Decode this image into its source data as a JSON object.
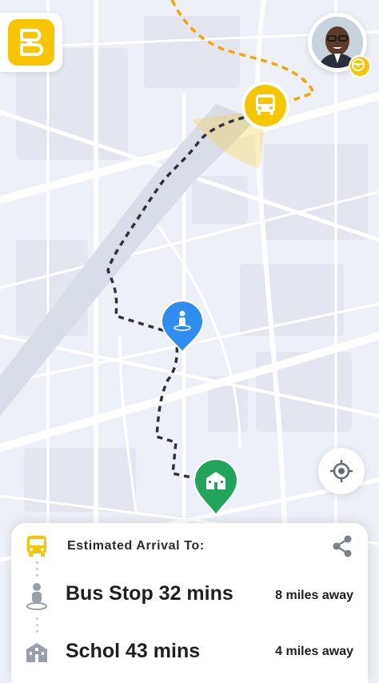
{
  "colors": {
    "accent": "#f7c600",
    "route_to_stop": "#333333",
    "route_bus": "#f0a800",
    "stop_pin": "#2f8df0",
    "school_pin": "#22a45a",
    "map_bg": "#eef0f7"
  },
  "icons": {
    "app_logo": "app-logo-icon",
    "bus_marker": "bus-icon",
    "stop_marker": "person-pin-icon",
    "school_marker": "school-icon",
    "locate": "crosshair-icon",
    "share": "share-icon",
    "driver_badge": "steering-wheel-icon"
  },
  "arrival": {
    "title": "Estimated Arrival To:",
    "rows": [
      {
        "name": "Bus Stop",
        "time": "32 mins",
        "distance": "8 miles away"
      },
      {
        "name": "Schol",
        "time": "43 mins",
        "distance": "4 miles away"
      }
    ]
  }
}
